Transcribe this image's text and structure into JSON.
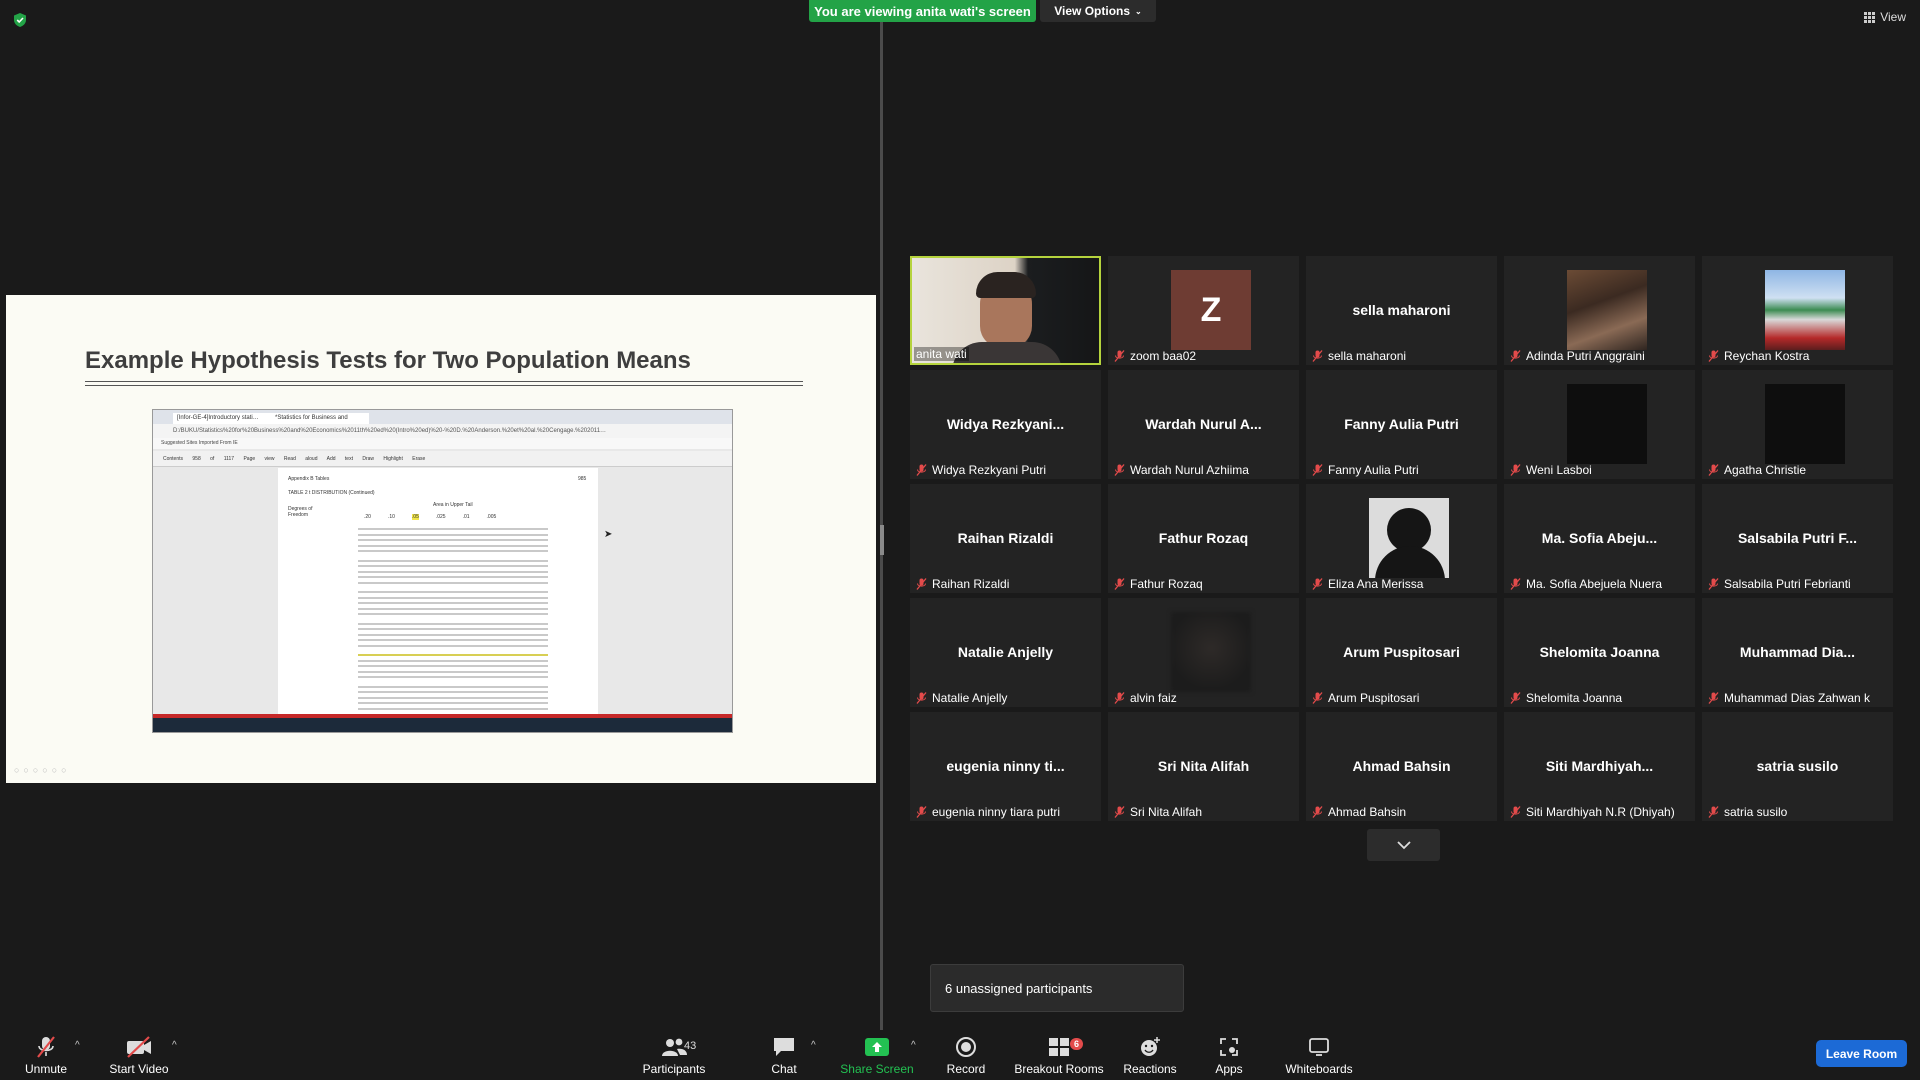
{
  "banner": {
    "viewing": "You are viewing anita wati's screen",
    "view_options": "View Options"
  },
  "view_button": "View",
  "slide": {
    "title": "Example Hypothesis Tests for Two Population Means",
    "browser_tab1": "[Infor-GE-4]Introductory stati…",
    "browser_tab2": "*Statistics for Business and Econ…",
    "address": "D:/BUKU/Statistics%20for%20Business%20and%20Economics%2011th%20ed%20(Intro%20ed)%20-%20D.%20Anderson.%20et%20al.%20Cengage.%202011…",
    "bookmarks": "Suggested Sites   Imported From IE",
    "toolbar": "Contents 958 of 1117 Page view Read aloud Add text Draw Highlight Erase",
    "pdf_appendix": "Appendix B   Tables",
    "pdf_page": "985",
    "pdf_table": "TABLE 2   t DISTRIBUTION (Continued)",
    "pdf_area": "Area in Upper Tail",
    "pdf_df": "Degrees of Freedom",
    "pdf_cols": [
      ".20",
      ".10",
      ".05",
      ".025",
      ".01",
      ".005"
    ]
  },
  "participants": [
    {
      "name": "anita wati",
      "type": "video",
      "muted": false,
      "active": true
    },
    {
      "name": "zoom baa02",
      "type": "letter",
      "letter": "Z",
      "muted": true
    },
    {
      "name": "sella maharoni",
      "type": "text",
      "big": "sella maharoni",
      "muted": true
    },
    {
      "name": "Adinda Putri Anggraini",
      "type": "photo",
      "muted": true
    },
    {
      "name": "Reychan Kostra",
      "type": "photo2",
      "muted": true
    },
    {
      "name": "Widya Rezkyani Putri",
      "type": "text",
      "big": "Widya  Rezkyani...",
      "muted": true
    },
    {
      "name": "Wardah Nurul Azhiima",
      "type": "text",
      "big": "Wardah  Nurul  A...",
      "muted": true
    },
    {
      "name": "Fanny Aulia Putri",
      "type": "text",
      "big": "Fanny Aulia Putri",
      "muted": true
    },
    {
      "name": "Weni Lasboi",
      "type": "black",
      "muted": true
    },
    {
      "name": "Agatha Christie",
      "type": "black",
      "muted": true
    },
    {
      "name": "Raihan Rizaldi",
      "type": "text",
      "big": "Raihan Rizaldi",
      "muted": true
    },
    {
      "name": "Fathur Rozaq",
      "type": "text",
      "big": "Fathur Rozaq",
      "muted": true
    },
    {
      "name": "Eliza Ana Merissa",
      "type": "silhouette",
      "muted": true
    },
    {
      "name": "Ma. Sofia Abejuela Nuera",
      "type": "text",
      "big": "Ma.  Sofia  Abeju...",
      "muted": true
    },
    {
      "name": "Salsabila Putri Febrianti",
      "type": "text",
      "big": "Salsabila  Putri  F...",
      "muted": true
    },
    {
      "name": "Natalie Anjelly",
      "type": "text",
      "big": "Natalie Anjelly",
      "muted": true
    },
    {
      "name": "alvin faiz",
      "type": "blur",
      "muted": true
    },
    {
      "name": "Arum Puspitosari",
      "type": "text",
      "big": "Arum Puspitosari",
      "muted": true
    },
    {
      "name": "Shelomita Joanna",
      "type": "text",
      "big": "Shelomita Joanna",
      "muted": true
    },
    {
      "name": "Muhammad Dias Zahwan k",
      "type": "text",
      "big": "Muhammad  Dia...",
      "muted": true
    },
    {
      "name": "eugenia ninny tiara putri",
      "type": "text",
      "big": "eugenia  ninny  ti...",
      "muted": true
    },
    {
      "name": "Sri Nita Alifah",
      "type": "text",
      "big": "Sri Nita Alifah",
      "muted": true
    },
    {
      "name": "Ahmad Bahsin",
      "type": "text",
      "big": "Ahmad Bahsin",
      "muted": true
    },
    {
      "name": "Siti Mardhiyah N.R (Dhiyah)",
      "type": "text",
      "big": "Siti  Mardhiyah...",
      "muted": true
    },
    {
      "name": "satria susilo",
      "type": "text",
      "big": "satria susilo",
      "muted": true
    }
  ],
  "popup": "6 unassigned participants",
  "toolbar": {
    "unmute": "Unmute",
    "start_video": "Start Video",
    "participants": "Participants",
    "participants_count": "43",
    "chat": "Chat",
    "share_screen": "Share Screen",
    "record": "Record",
    "breakout": "Breakout Rooms",
    "breakout_badge": "6",
    "reactions": "Reactions",
    "apps": "Apps",
    "whiteboards": "Whiteboards",
    "leave": "Leave Room"
  },
  "colors": {
    "share_green": "#23a347",
    "active_border": "#b5d33d",
    "leave_blue": "#1c6ad6",
    "muted_red": "#e34b4b"
  }
}
